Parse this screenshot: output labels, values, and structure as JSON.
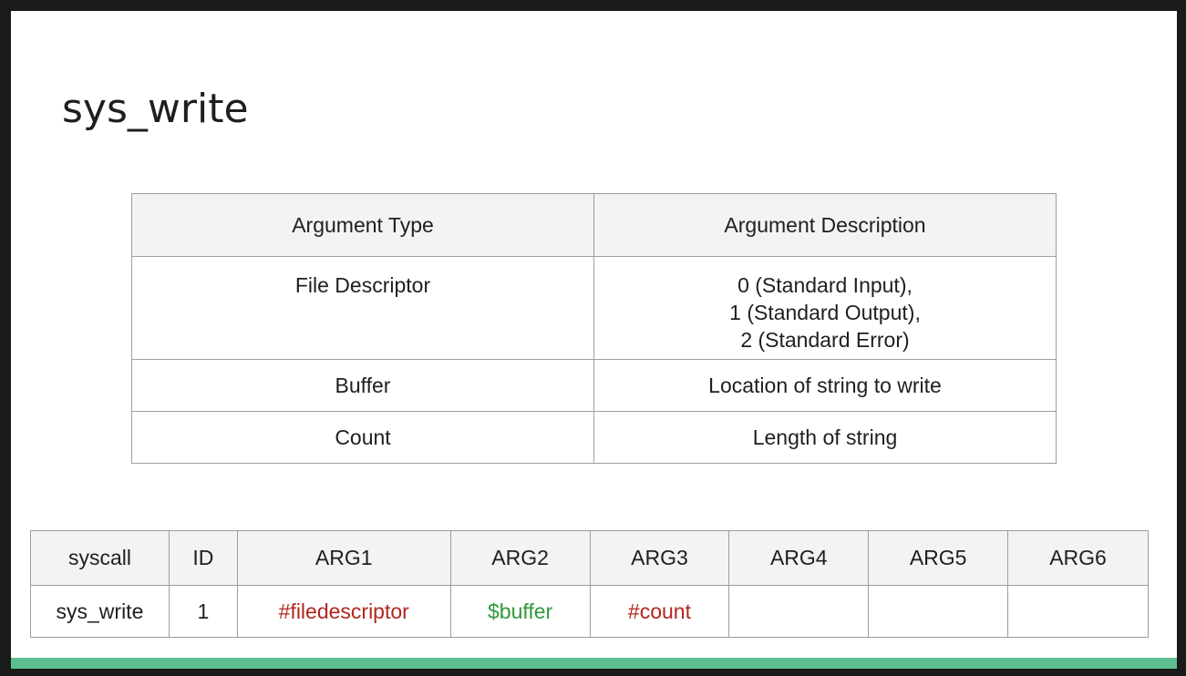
{
  "slide": {
    "title": "sys_write"
  },
  "args_table": {
    "headers": [
      "Argument Type",
      "Argument Description"
    ],
    "rows": [
      {
        "type": "File Descriptor",
        "description_lines": [
          "0 (Standard Input),",
          "1 (Standard Output),",
          "2 (Standard Error)"
        ]
      },
      {
        "type": "Buffer",
        "description": "Location of string to write"
      },
      {
        "type": "Count",
        "description": "Length of string"
      }
    ]
  },
  "reg_table": {
    "headers": [
      "syscall",
      "ID",
      "ARG1",
      "ARG2",
      "ARG3",
      "ARG4",
      "ARG5",
      "ARG6"
    ],
    "row": {
      "syscall": "sys_write",
      "id": "1",
      "arg1": "#filedescriptor",
      "arg2": "$buffer",
      "arg3": "#count",
      "arg4": "",
      "arg5": "",
      "arg6": ""
    }
  },
  "colors": {
    "immediate_arg": "#b3261e",
    "buffer_arg": "#2e9a3a",
    "footer_accent": "#5cbf90"
  }
}
